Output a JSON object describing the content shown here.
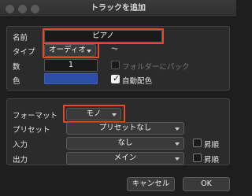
{
  "window": {
    "title": "トラックを追加"
  },
  "track": {
    "name_label": "名前",
    "name_value": "ピアノ",
    "type_label": "タイプ",
    "type_value": "オーディオ",
    "folder_label": "フォルダーにパック",
    "count_label": "数",
    "count_value": "1",
    "color_label": "色",
    "color_hex": "#2b4fa6",
    "auto_color_label": "自動配色",
    "auto_color_checked": true
  },
  "io": {
    "format_label": "フォーマット",
    "format_value": "モノ",
    "preset_label": "プリセット",
    "preset_value": "プリセットなし",
    "input_label": "入力",
    "input_value": "なし",
    "input_asc_label": "昇順",
    "output_label": "出力",
    "output_value": "メイン",
    "output_asc_label": "昇順"
  },
  "buttons": {
    "cancel": "キャンセル",
    "ok": "OK"
  },
  "annotations": {
    "highlight_color": "#e24a2d"
  }
}
